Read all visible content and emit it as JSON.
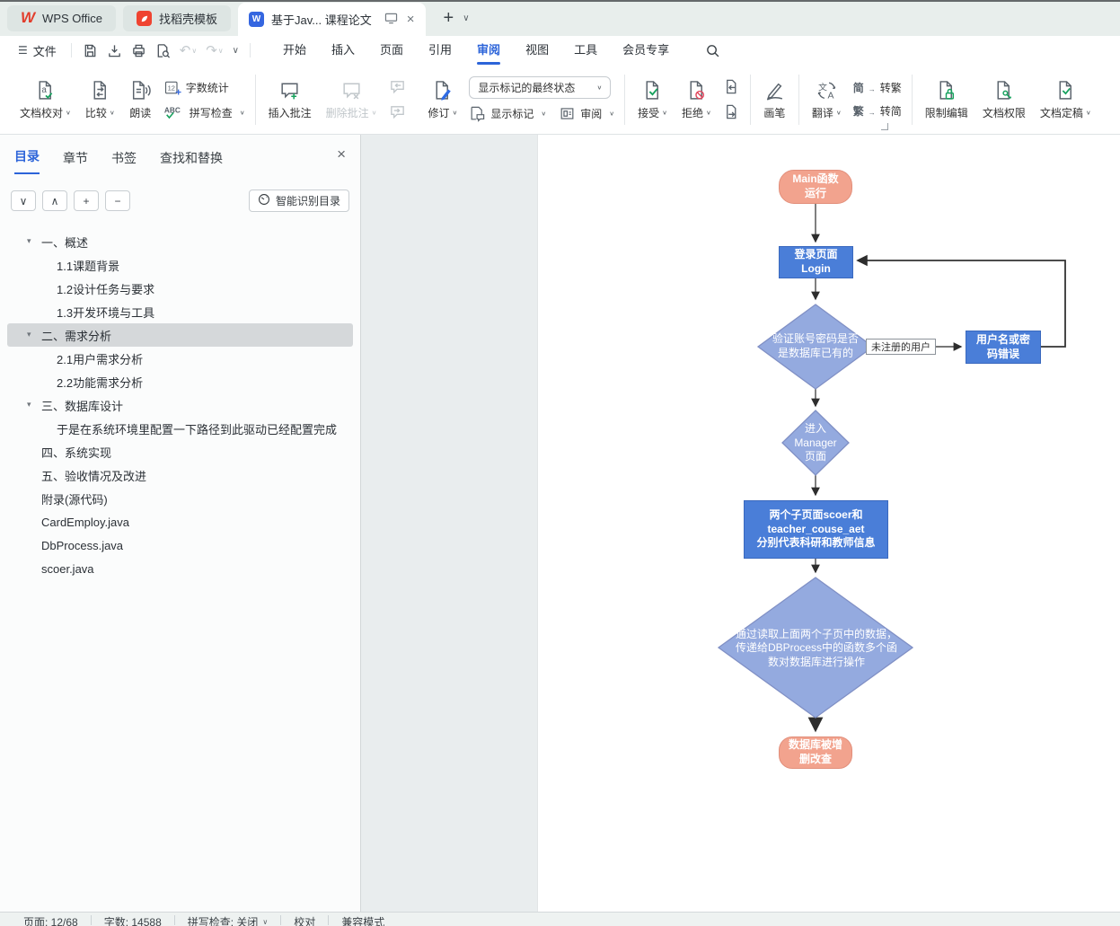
{
  "titlebar": {
    "tab_wps": "WPS Office",
    "tab_docer": "找稻壳模板",
    "tab_doc": "基于Jav... 课程论文"
  },
  "menubar": {
    "file": "文件",
    "tabs": [
      "开始",
      "插入",
      "页面",
      "引用",
      "审阅",
      "视图",
      "工具",
      "会员专享"
    ]
  },
  "ribbon": {
    "doc_proof": "文档校对",
    "compare": "比较",
    "read_aloud": "朗读",
    "word_count": "字数统计",
    "wc_num": "12",
    "abc": "ABC",
    "spell_check": "拼写检查",
    "insert_comment": "插入批注",
    "delete_comment": "删除批注",
    "track_changes": "修订",
    "markup_state": "显示标记的最终状态",
    "show_markup": "显示标记",
    "review_pane": "审阅",
    "accept": "接受",
    "reject": "拒绝",
    "ink": "画笔",
    "translate": "翻译",
    "s2t_char": "简",
    "to_traditional": "转繁",
    "t2s_char": "繁",
    "to_simplified": "转简",
    "restrict_edit": "限制编辑",
    "doc_permission": "文档权限",
    "finalize": "文档定稿"
  },
  "sidebar": {
    "tabs": [
      "目录",
      "章节",
      "书签",
      "查找和替换"
    ],
    "smart": "智能识别目录",
    "toc": [
      {
        "label": "一、概述"
      },
      {
        "label": "1.1课题背景"
      },
      {
        "label": "1.2设计任务与要求"
      },
      {
        "label": "1.3开发环境与工具"
      },
      {
        "label": "二、需求分析"
      },
      {
        "label": "2.1用户需求分析"
      },
      {
        "label": "2.2功能需求分析"
      },
      {
        "label": "三、数据库设计"
      },
      {
        "label": "于是在系统环境里配置一下路径到此驱动已经配置完成"
      },
      {
        "label": "四、系统实现"
      },
      {
        "label": "五、验收情况及改进"
      },
      {
        "label": "附录(源代码)"
      },
      {
        "label": "CardEmploy.java"
      },
      {
        "label": "DbProcess.java"
      },
      {
        "label": "scoer.java"
      }
    ]
  },
  "flowchart": {
    "colors": {
      "terminator": "#F2A38E",
      "process": "#4A7ED8",
      "decision": "#94AADF"
    },
    "nodes": {
      "start": "Main函数\n运行",
      "login": "登录页面\nLogin",
      "verify": "验证账号密码是否\n是数据库已有的",
      "edge_label": "未注册的用户",
      "error": "用户名或密\n码错误",
      "manager": "进入\nManager\n页面",
      "subpages": "两个子页面scoer和\nteacher_couse_aet\n分别代表科研和教师信息",
      "dbprocess": "通过读取上面两个子页中的数据，\n传递给DBProcess中的函数多个函\n数对数据库进行操作",
      "end": "数据库被增\n删改查"
    }
  },
  "statusbar": {
    "page": "页面: 12/68",
    "words": "字数: 14588",
    "spell": "拼写检查: 关闭",
    "proofread": "校对",
    "compat": "兼容模式"
  }
}
